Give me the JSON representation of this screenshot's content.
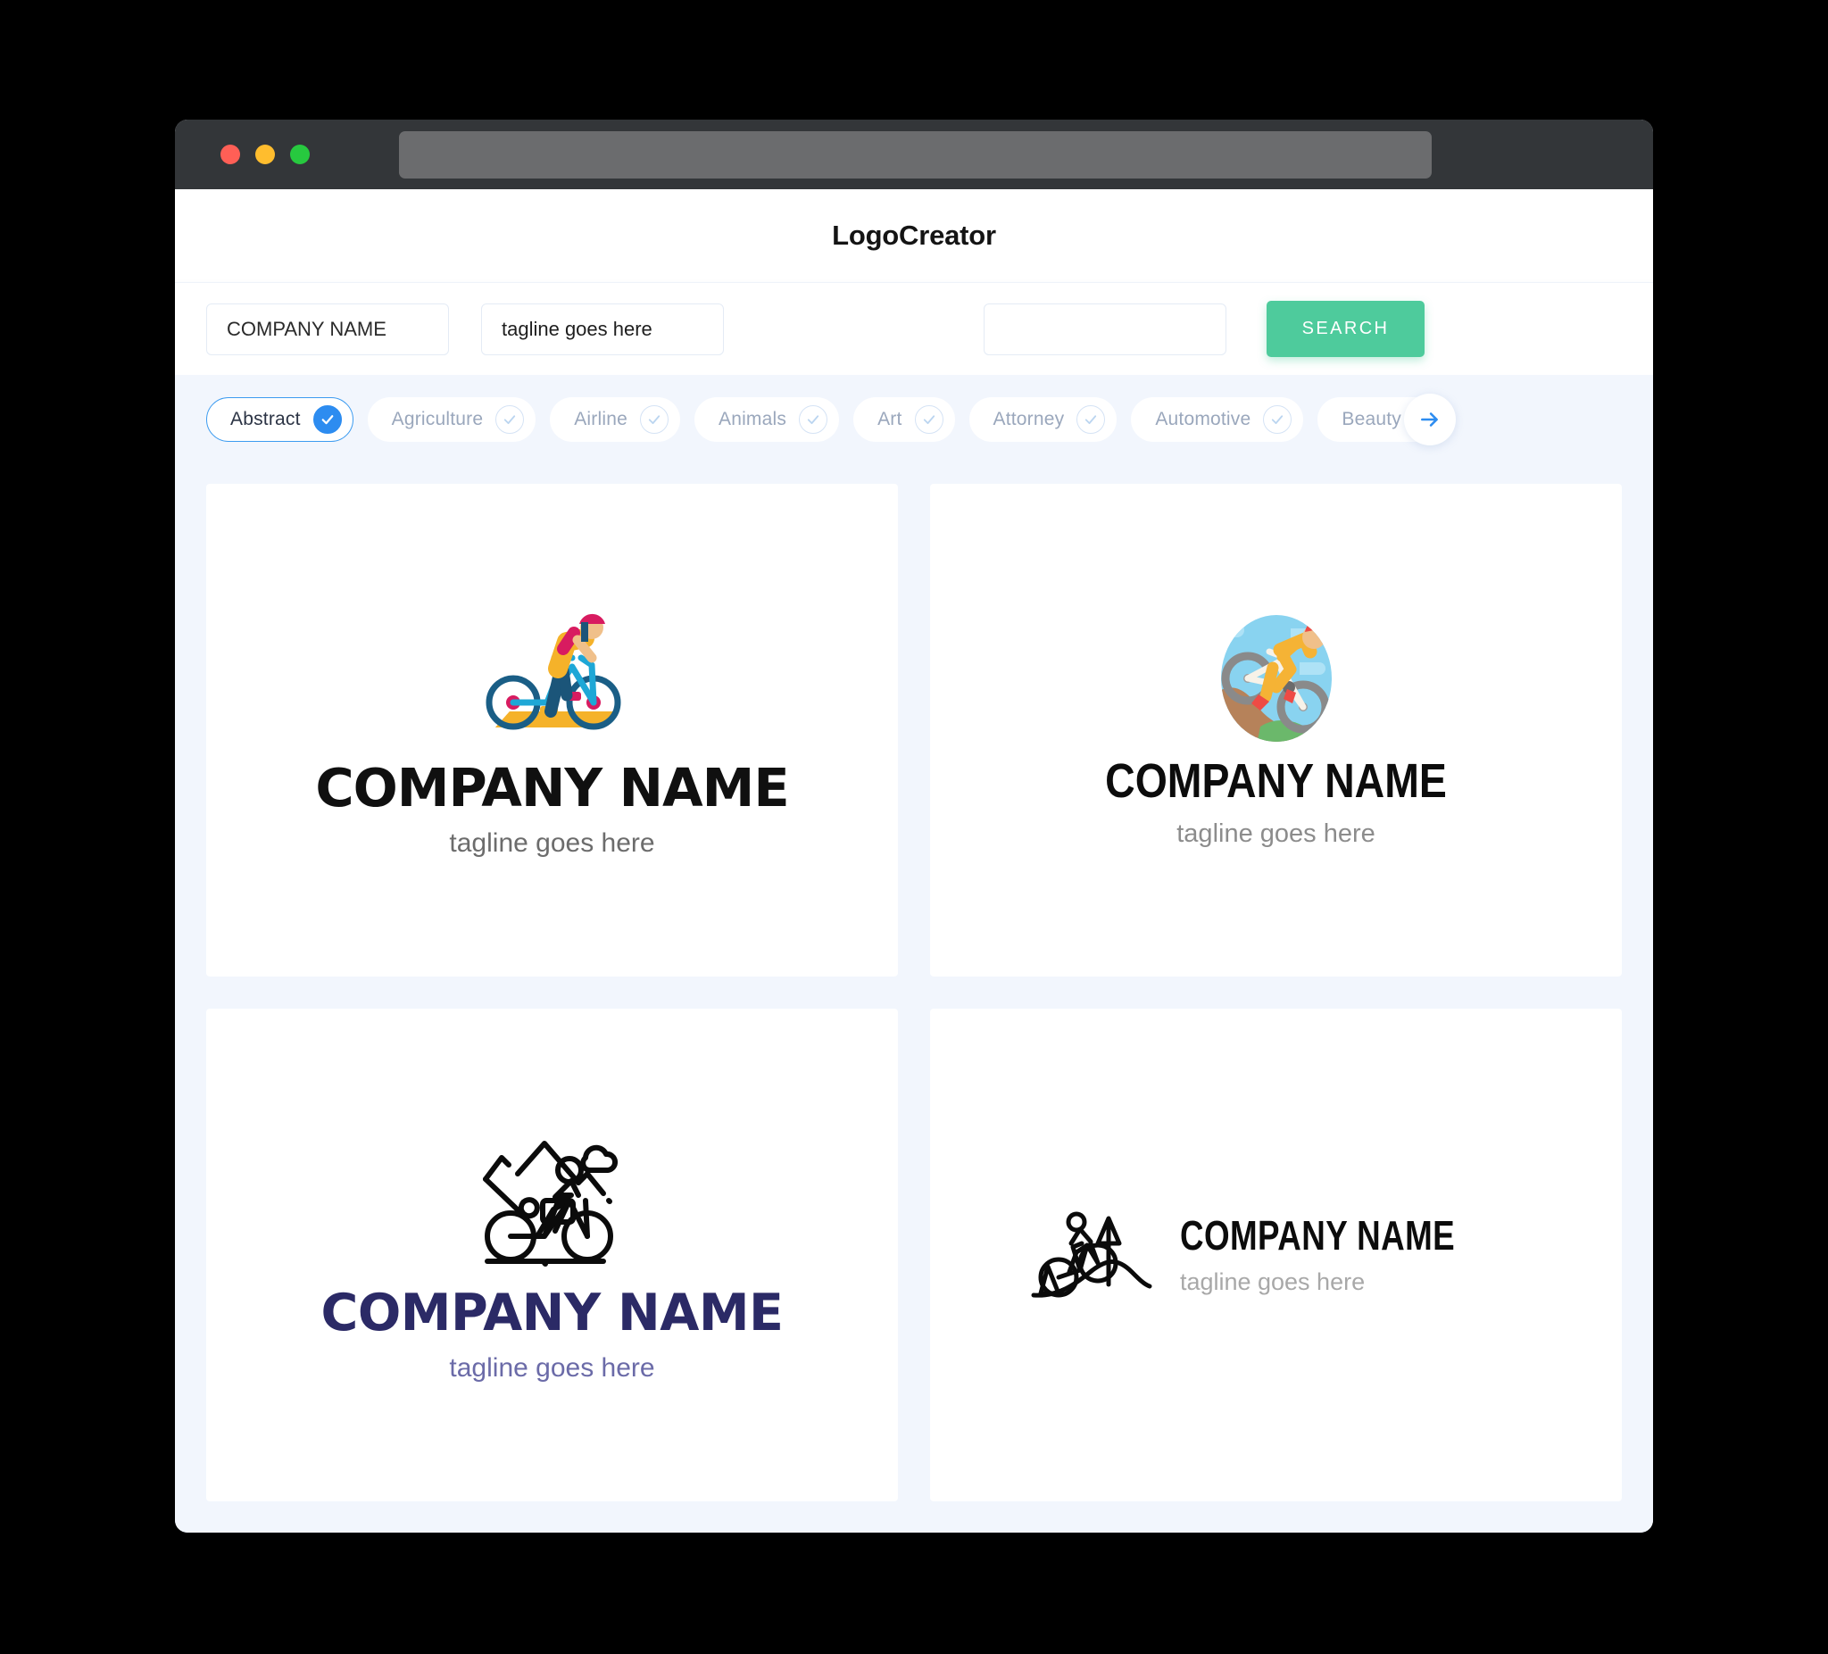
{
  "window": {
    "traffic_lights": [
      "close",
      "minimize",
      "maximize"
    ],
    "address_bar_value": "",
    "colors": {
      "titlebar": "#333639",
      "address_bar": "#6B6C6E",
      "page_background": "#F2F6FD",
      "accent_green": "#4ECB9C",
      "accent_blue": "#2D8CF0"
    }
  },
  "header": {
    "title": "LogoCreator"
  },
  "search": {
    "company_value": "COMPANY NAME",
    "company_placeholder": "COMPANY NAME",
    "tagline_value": "tagline goes here",
    "tagline_placeholder": "tagline goes here",
    "extra_value": "",
    "extra_placeholder": "",
    "button_label": "SEARCH"
  },
  "categories": {
    "next_label": "→",
    "items": [
      {
        "label": "Abstract",
        "selected": true
      },
      {
        "label": "Agriculture",
        "selected": false
      },
      {
        "label": "Airline",
        "selected": false
      },
      {
        "label": "Animals",
        "selected": false
      },
      {
        "label": "Art",
        "selected": false
      },
      {
        "label": "Attorney",
        "selected": false
      },
      {
        "label": "Automotive",
        "selected": false
      },
      {
        "label": "Beauty",
        "selected": false
      }
    ]
  },
  "logos": [
    {
      "icon": "flat-cyclist-on-ramp-icon",
      "company": "COMPANY NAME",
      "tagline": "tagline goes here",
      "text_color": "#101010",
      "tagline_color": "#6C6C6C",
      "layout": "stacked"
    },
    {
      "icon": "round-mountain-biker-badge-icon",
      "company": "COMPANY NAME",
      "tagline": "tagline goes here",
      "text_color": "#0C0C0C",
      "tagline_color": "#8C8C8C",
      "layout": "stacked"
    },
    {
      "icon": "line-art-cyclist-mountains-icon",
      "company": "COMPANY NAME",
      "tagline": "tagline goes here",
      "text_color": "#2B2A66",
      "tagline_color": "#6B6BA8",
      "layout": "stacked"
    },
    {
      "icon": "line-art-cyclist-tree-icon",
      "company": "COMPANY NAME",
      "tagline": "tagline goes here",
      "text_color": "#0C0C0C",
      "tagline_color": "#A8A8A8",
      "layout": "horizontal"
    }
  ]
}
